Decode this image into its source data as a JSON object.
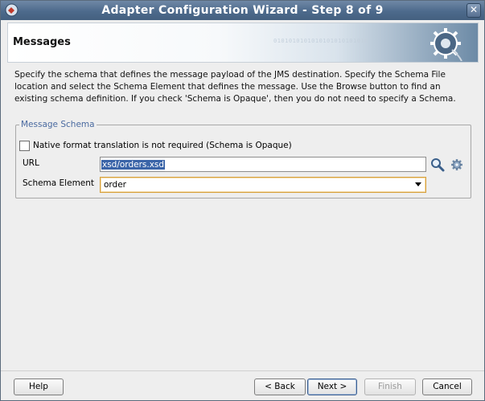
{
  "window": {
    "title": "Adapter Configuration Wizard - Step 8 of 9",
    "close_symbol": "✕",
    "app_icon": "oracle-jdeveloper-icon"
  },
  "header": {
    "title": "Messages",
    "decoration_text": "0101010101010101010101010",
    "banner_icon": "gear-adapter-icon"
  },
  "description": "Specify the schema that defines the message payload of the JMS destination.  Specify the Schema File location and select the Schema Element that defines the message. Use the Browse button to find an existing schema definition. If you check 'Schema is Opaque', then you do not need to specify a Schema.",
  "message_schema": {
    "legend": "Message Schema",
    "opaque_checkbox": {
      "label": "Native format translation is not required (Schema is Opaque)",
      "checked": false
    },
    "url": {
      "label": "URL",
      "value": "xsd/orders.xsd",
      "browse_icon": "search-icon",
      "settings_icon": "gear-icon"
    },
    "schema_element": {
      "label": "Schema Element",
      "value": "order"
    }
  },
  "buttons": {
    "help": "Help",
    "back": "< Back",
    "next": "Next >",
    "finish": "Finish",
    "cancel": "Cancel"
  },
  "colors": {
    "title_bar": "#4d6a8c",
    "legend_text": "#4a6aa0",
    "selection": "#3a64a8",
    "focus_border": "#d7a13f"
  }
}
